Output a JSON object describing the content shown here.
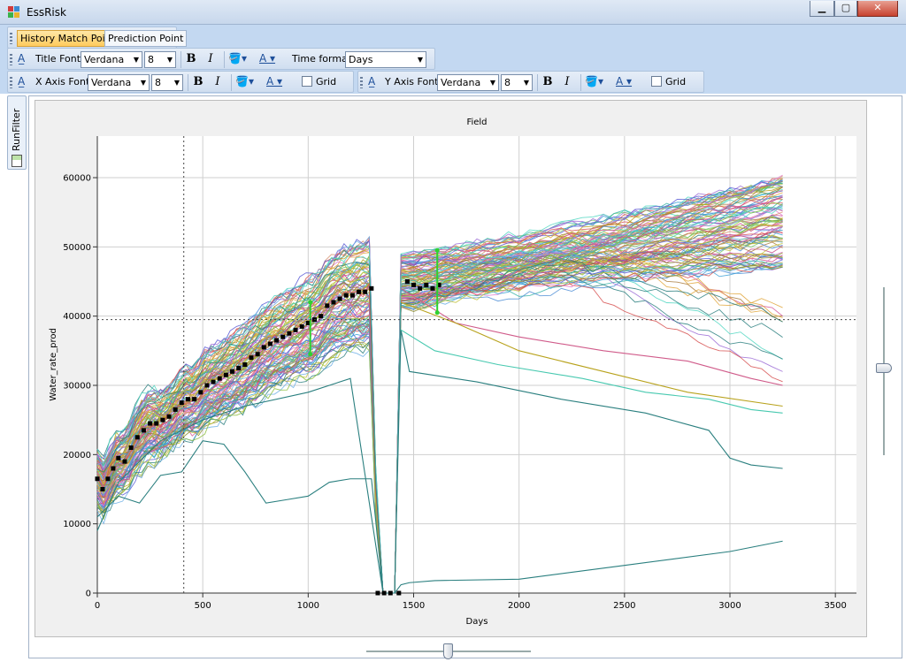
{
  "window": {
    "title": "EssRisk",
    "icon": "app-grid-icon"
  },
  "toolbar": {
    "tabs": [
      {
        "label": "History Match Point",
        "active": true
      },
      {
        "label": "Prediction Point",
        "active": false
      }
    ],
    "row2": {
      "font_label": "Title Font",
      "font_value": "Verdana",
      "size_value": "8",
      "bold": "B",
      "italic": "I",
      "time_format_label": "Time format",
      "time_format_value": "Days"
    },
    "row3": {
      "x_font_label": "X Axis Font",
      "x_font_value": "Verdana",
      "x_size_value": "8",
      "x_grid_label": "Grid",
      "y_font_label": "Y Axis Font",
      "y_font_value": "Verdana",
      "y_size_value": "8",
      "y_grid_label": "Grid",
      "bold": "B",
      "italic": "I"
    }
  },
  "side_panel": {
    "label": "RunFilter"
  },
  "chart_data": {
    "type": "line",
    "title": "Field",
    "xlabel": "Days",
    "ylabel": "Water_rate_prod",
    "xlim": [
      0,
      3600
    ],
    "ylim": [
      0,
      66000
    ],
    "x_ticks": [
      "0",
      "500",
      "1000",
      "1500",
      "2000",
      "2500",
      "3000",
      "3500"
    ],
    "y_ticks": [
      "0",
      "10000",
      "20000",
      "30000",
      "40000",
      "50000",
      "60000"
    ],
    "grid": true,
    "cursor": {
      "x": 410,
      "y": 39500
    },
    "history_points": {
      "x": [
        0,
        25,
        50,
        75,
        100,
        130,
        160,
        190,
        220,
        250,
        280,
        310,
        340,
        370,
        400,
        430,
        460,
        490,
        520,
        550,
        580,
        610,
        640,
        670,
        700,
        730,
        760,
        790,
        820,
        850,
        880,
        910,
        940,
        970,
        1000,
        1030,
        1060,
        1090,
        1120,
        1150,
        1180,
        1210,
        1240,
        1270,
        1300,
        1330,
        1360,
        1390,
        1430,
        1470,
        1500,
        1530,
        1560,
        1590,
        1620
      ],
      "y": [
        16500,
        15000,
        16500,
        18000,
        19500,
        19000,
        21000,
        22500,
        23500,
        24500,
        24500,
        25000,
        25500,
        26500,
        27500,
        28000,
        28000,
        29000,
        30000,
        30500,
        31000,
        31500,
        32000,
        32500,
        33000,
        34000,
        34500,
        35500,
        36000,
        36500,
        37000,
        37500,
        38000,
        38500,
        39000,
        39500,
        40000,
        41500,
        42000,
        42500,
        43000,
        43000,
        43500,
        43500,
        44000,
        0,
        0,
        0,
        0,
        45000,
        44500,
        44000,
        44500,
        44000,
        44500
      ]
    },
    "error_bars": [
      {
        "x": 1010,
        "low": 34500,
        "high": 42000
      },
      {
        "x": 1612,
        "low": 40500,
        "high": 49500
      }
    ],
    "series_colors": [
      "#4f8fd6",
      "#d65b9b",
      "#8bbd3a",
      "#e0a63a",
      "#3ab5a8",
      "#9b6bd6",
      "#c2c23a",
      "#d64f4f",
      "#4fd6c1",
      "#2a7f7f",
      "#b8a21c",
      "#6fb0e6",
      "#e07ad0",
      "#75c96a",
      "#a97b3d",
      "#5a5ad6",
      "#d68f6b",
      "#39a0d6",
      "#c94a8a",
      "#8a8a2e"
    ],
    "outlier_series": [
      {
        "color": "#2a7f7f",
        "x": [
          0,
          100,
          200,
          300,
          400,
          500,
          600,
          700,
          800,
          900,
          1000,
          1100,
          1200,
          1300,
          1355,
          1375,
          1395,
          1410,
          1440,
          1480,
          1600,
          2000,
          2500,
          3000,
          3250
        ],
        "y": [
          11000,
          14000,
          13000,
          17000,
          17500,
          22000,
          21500,
          17500,
          13000,
          13500,
          14000,
          16000,
          16500,
          16500,
          0,
          0,
          0,
          0,
          1200,
          1500,
          1800,
          2000,
          4000,
          6000,
          7500
        ]
      },
      {
        "color": "#2a7f7f",
        "x": [
          0,
          100,
          200,
          300,
          500,
          700,
          1000,
          1200,
          1355,
          1395,
          1410,
          1440,
          1480,
          1800,
          2200,
          2600,
          2900,
          3000,
          3100,
          3250
        ],
        "y": [
          9000,
          16000,
          19000,
          22000,
          25000,
          27000,
          29000,
          31000,
          0,
          0,
          0,
          38000,
          32000,
          30500,
          28000,
          26000,
          23500,
          19500,
          18500,
          18000
        ]
      },
      {
        "color": "#48c9b0",
        "x": [
          1440,
          1600,
          1900,
          2300,
          2600,
          2900,
          3100,
          3250
        ],
        "y": [
          38000,
          35000,
          33000,
          31000,
          29000,
          28000,
          26500,
          26000
        ]
      },
      {
        "color": "#d05b8a",
        "x": [
          1440,
          1700,
          2000,
          2400,
          2800,
          3100,
          3250
        ],
        "y": [
          44000,
          39000,
          37000,
          35000,
          33500,
          31000,
          30000
        ]
      },
      {
        "color": "#b8a21c",
        "x": [
          1440,
          1700,
          2000,
          2400,
          2800,
          3250
        ],
        "y": [
          42000,
          39000,
          35000,
          32000,
          29000,
          27000
        ]
      }
    ]
  }
}
